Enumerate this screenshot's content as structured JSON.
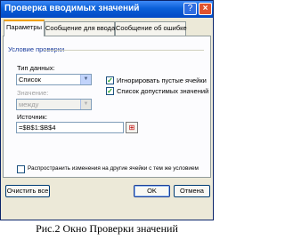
{
  "window": {
    "title": "Проверка вводимых значений",
    "help_symbol": "?",
    "close_symbol": "×"
  },
  "tabs": [
    {
      "label": "Параметры",
      "active": true
    },
    {
      "label": "Сообщение для ввода",
      "active": false
    },
    {
      "label": "Сообщение об ошибке",
      "active": false
    }
  ],
  "settings": {
    "group_label": "Условие проверки",
    "data_type_label": "Тип данных:",
    "data_type_value": "Список",
    "value_label": "Значение:",
    "value_value": "между",
    "ignore_blank": {
      "label": "Игнорировать пустые ячейки",
      "checked": true
    },
    "in_cell_dropdown": {
      "label": "Список допустимых значений",
      "checked": true
    },
    "source_label": "Источник:",
    "source_value": "=$B$1:$B$4",
    "apply_all": {
      "label": "Распространить изменения на другие ячейки с тем же условием",
      "checked": false
    }
  },
  "buttons": {
    "clear_all": "Очистить все",
    "ok": "OK",
    "cancel": "Отмена"
  },
  "caption": "Рис.2  Окно Проверки значений",
  "icons": {
    "dropdown_arrow": "▼",
    "check_mark": "✓",
    "ref_button": "⊞"
  }
}
